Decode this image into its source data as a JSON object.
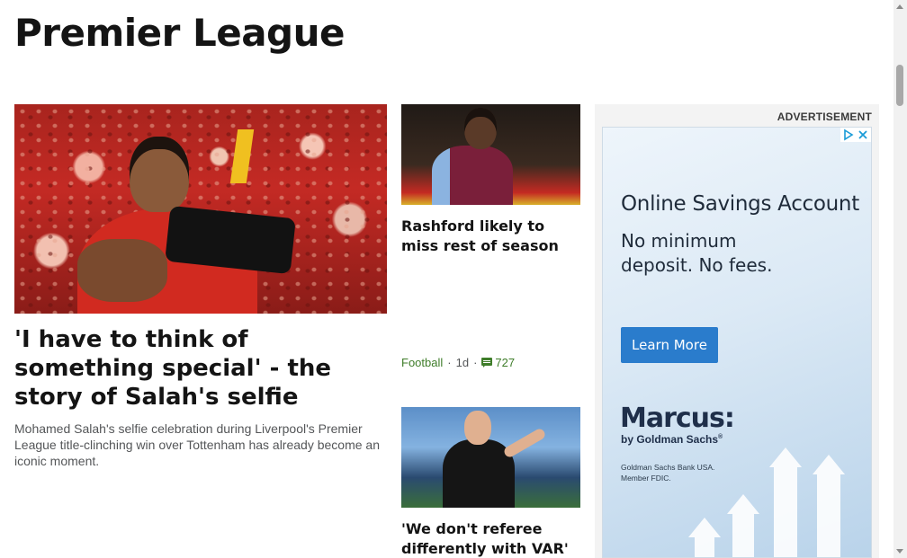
{
  "page": {
    "title": "Premier League"
  },
  "lead_story": {
    "headline": "'I have to think of something special' - the story of Salah's selfie",
    "summary": "Mohamed Salah's selfie celebration during Liverpool's Premier League title-clinching win over Tottenham has already become an iconic moment."
  },
  "stories": [
    {
      "headline": "Rashford likely to miss rest of season",
      "topic": "Football",
      "age": "1d",
      "comments": "727"
    },
    {
      "headline": "'We don't referee differently with VAR'"
    }
  ],
  "advertisement": {
    "label": "ADVERTISEMENT",
    "heading": "Online Savings Account",
    "body": "No minimum deposit. No fees.",
    "cta": "Learn More",
    "brand": "Marcus:",
    "brand_sub": "by Goldman Sachs",
    "brand_sub_mark": "®",
    "legal": "Goldman Sachs Bank USA. Member FDIC.",
    "colors": {
      "cta": "#2a7ccc",
      "brand": "#1f2f4a"
    }
  },
  "theme": {
    "topic_color": "#3f7d2a",
    "text_color": "#141414",
    "summary_color": "#545658"
  }
}
